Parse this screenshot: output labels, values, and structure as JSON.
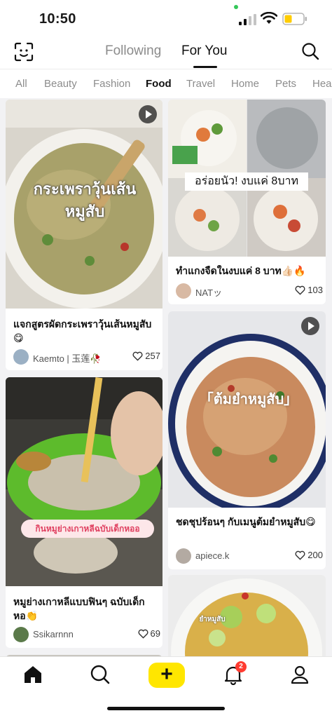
{
  "status": {
    "time": "10:50"
  },
  "header": {
    "tabs": [
      {
        "label": "Following",
        "active": false
      },
      {
        "label": "For You",
        "active": true
      }
    ]
  },
  "categories": [
    "All",
    "Beauty",
    "Fashion",
    "Food",
    "Travel",
    "Home",
    "Pets",
    "Hea"
  ],
  "active_category": "Food",
  "feed": [
    {
      "title": "แจกสูตรผัดกระเพราวุ้นเส้นหมูสับ 😋",
      "overlay": "กระเพราวุ้นเส้น หมูสับ",
      "author": "Kaemto | 玉莲🥀",
      "likes": "257",
      "video": true
    },
    {
      "title": "ทำแกงจืดในงบแค่ 8 บาท👍🏻🔥",
      "overlay": "อร่อยนัว! งบแค่ 8บาท",
      "author": "NATッ",
      "likes": "103",
      "video": false
    },
    {
      "title": "หมูย่างเกาหลีแบบฟินๆ ฉบับเด็กหอ👏",
      "overlay": "กินหมูย่างเกาหลีฉบับเด็กหออ",
      "author": "Ssikarnnn",
      "likes": "69",
      "video": false
    },
    {
      "title": "ชดชุปร้อนๆ กับเมนูต้มยำหมูสับ😋",
      "overlay": "「ต้มยำหมูสับ」",
      "author": "apiece.k",
      "likes": "200",
      "video": true
    },
    {
      "title": "",
      "overlay": "ยำหมูสับ",
      "author": "",
      "likes": "",
      "video": false
    }
  ],
  "bottom_nav": {
    "items": [
      "home-icon",
      "search-icon",
      "create-icon",
      "bell-icon",
      "profile-icon"
    ],
    "notification_count": "2"
  },
  "colors": {
    "accent": "#ffe600",
    "badge": "#ff3b30",
    "text": "#111111",
    "muted": "#8b8b8b"
  }
}
